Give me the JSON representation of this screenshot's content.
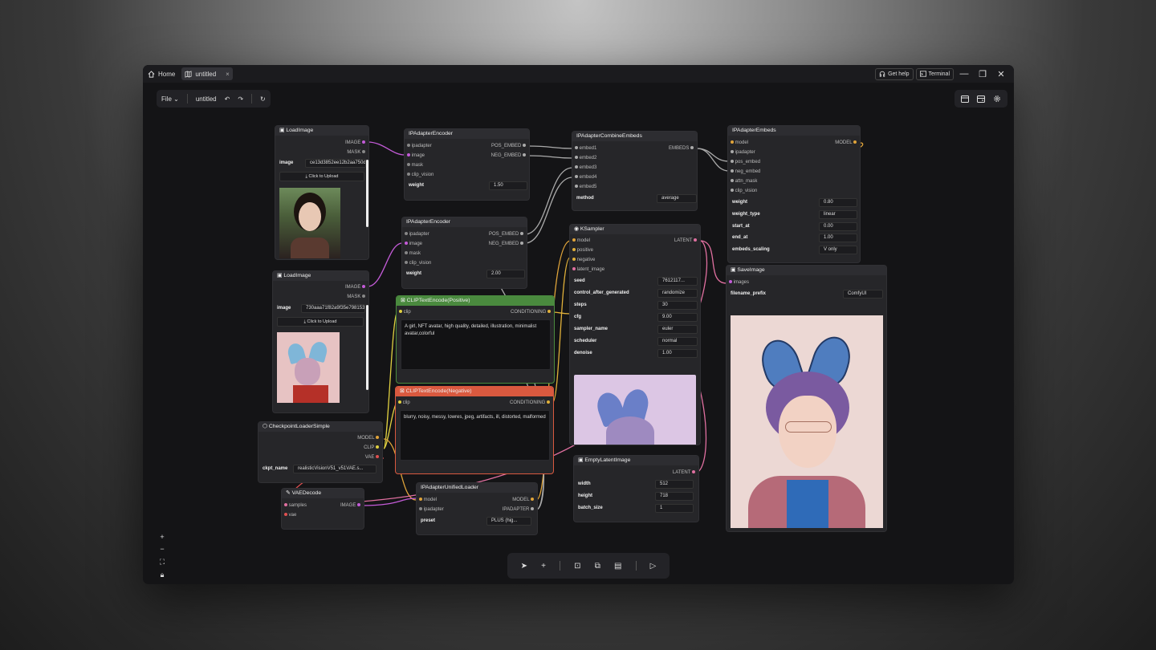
{
  "titlebar": {
    "home": "Home",
    "tab": "untitled",
    "tab_close": "×",
    "get_help": "Get help",
    "terminal": "Terminal"
  },
  "topbar": {
    "file": "File",
    "workflow": "untitled"
  },
  "nodes": {
    "load1": {
      "title": "LoadImage",
      "out1": "IMAGE",
      "out2": "MASK",
      "w_label": "image",
      "w_value": "ce13d3852ee12b2aa750dd",
      "upload": "Click to Upload"
    },
    "load2": {
      "title": "LoadImage",
      "out1": "IMAGE",
      "out2": "MASK",
      "w_label": "image",
      "w_value": "730aaa71f82a9f35e798153",
      "upload": "Click to Upload"
    },
    "enc1": {
      "title": "IPAdapterEncoder",
      "in1": "ipadapter",
      "in2": "image",
      "in3": "mask",
      "in4": "clip_vision",
      "out1": "POS_EMBED",
      "out2": "NEG_EMBED",
      "w_label": "weight",
      "w_value": "1.50"
    },
    "enc2": {
      "title": "IPAdapterEncoder",
      "in1": "ipadapter",
      "in2": "image",
      "in3": "mask",
      "in4": "clip_vision",
      "out1": "POS_EMBED",
      "out2": "NEG_EMBED",
      "w_label": "weight",
      "w_value": "2.00"
    },
    "combine": {
      "title": "IPAdapterCombineEmbeds",
      "in1": "embed1",
      "in2": "embed2",
      "in3": "embed3",
      "in4": "embed4",
      "in5": "embed5",
      "out1": "EMBEDS",
      "w_label": "method",
      "w_value": "average"
    },
    "embeds": {
      "title": "IPAdapterEmbeds",
      "in1": "model",
      "in2": "ipadapter",
      "in3": "pos_embed",
      "in4": "neg_embed",
      "in5": "attn_mask",
      "in6": "clip_vision",
      "out1": "MODEL",
      "widgets": [
        {
          "label": "weight",
          "value": "0.80"
        },
        {
          "label": "weight_type",
          "value": "linear"
        },
        {
          "label": "start_at",
          "value": "0.00"
        },
        {
          "label": "end_at",
          "value": "1.00"
        },
        {
          "label": "embeds_scaling",
          "value": "V only"
        }
      ]
    },
    "ksampler": {
      "title": "KSampler",
      "in1": "model",
      "in2": "positive",
      "in3": "negative",
      "in4": "latent_image",
      "out1": "LATENT",
      "widgets": [
        {
          "label": "seed",
          "value": "7612117..."
        },
        {
          "label": "control_after_generated",
          "value": "randomize"
        },
        {
          "label": "steps",
          "value": "30"
        },
        {
          "label": "cfg",
          "value": "9.00"
        },
        {
          "label": "sampler_name",
          "value": "euler"
        },
        {
          "label": "scheduler",
          "value": "normal"
        },
        {
          "label": "denoise",
          "value": "1.00"
        }
      ]
    },
    "save": {
      "title": "SaveImage",
      "in1": "images",
      "w_label": "filename_prefix",
      "w_value": "ComfyUI"
    },
    "pos": {
      "title": "CLIPTextEncode(Positive)",
      "in1": "clip",
      "out1": "CONDITIONING",
      "text": "A girl, NFT avatar, high quality, detailed, illustration, minimalist avatar,colorful"
    },
    "neg": {
      "title": "CLIPTextEncode(Negative)",
      "in1": "clip",
      "out1": "CONDITIONING",
      "text": "blurry, noisy, messy, lowres, jpeg, artifacts, ill, distorted, malformed"
    },
    "ckpt": {
      "title": "CheckpointLoaderSimple",
      "out1": "MODEL",
      "out2": "CLIP",
      "out3": "VAE",
      "w_label": "ckpt_name",
      "w_value": "realisticVisionV51_v51VAE.s..."
    },
    "vae": {
      "title": "VAEDecode",
      "in1": "samples",
      "in2": "vae",
      "out1": "IMAGE"
    },
    "unified": {
      "title": "IPAdapterUnifiedLoader",
      "in1": "model",
      "in2": "ipadapter",
      "out1": "MODEL",
      "out2": "IPADAPTER",
      "w_label": "preset",
      "w_value": "PLUS (hig..."
    },
    "latent": {
      "title": "EmptyLatentImage",
      "out1": "LATENT",
      "widgets": [
        {
          "label": "width",
          "value": "512"
        },
        {
          "label": "height",
          "value": "718"
        },
        {
          "label": "batch_size",
          "value": "1"
        }
      ]
    }
  },
  "colors": {
    "image": "#c45bd8",
    "model": "#e0a43a",
    "conditioning": "#e0b03a",
    "latent": "#e070a0",
    "clip": "#e0d040",
    "vae": "#e05050",
    "pos_header": "#4a8a3e",
    "neg_header": "#d9593f"
  }
}
